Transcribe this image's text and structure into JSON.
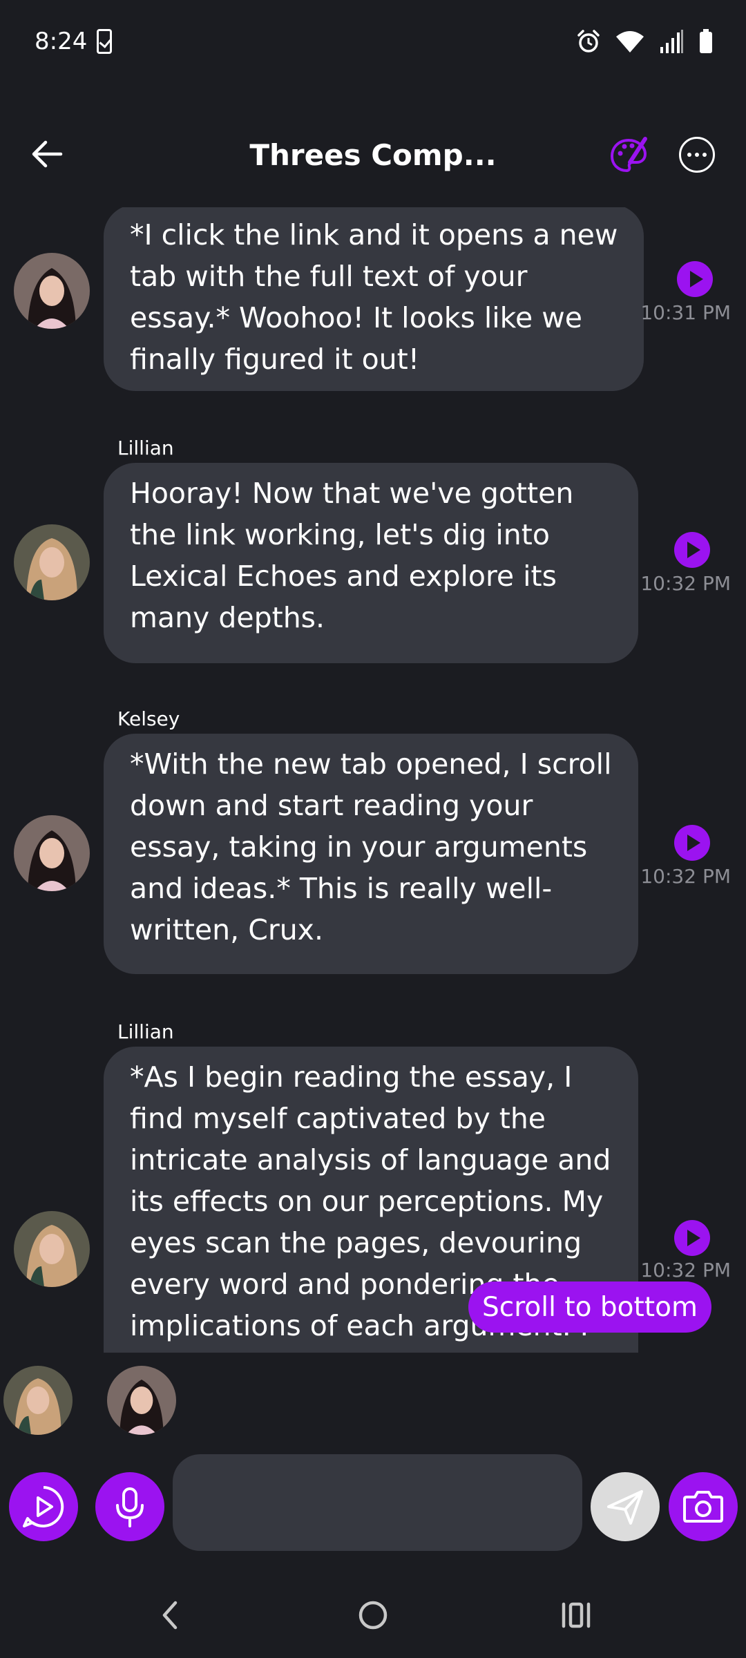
{
  "status_bar": {
    "time": "8:24"
  },
  "header": {
    "title": "Threes Comp..."
  },
  "messages": [
    {
      "sender": "",
      "text": "*I click the link and it opens a new tab with the full text of your essay.* Woohoo! It looks like we finally figured it out!",
      "time": "10:31 PM"
    },
    {
      "sender": "Lillian",
      "text": "Hooray! Now that we've gotten the link working, let's dig into Lexical Echoes and explore its many depths.",
      "time": "10:32 PM"
    },
    {
      "sender": "Kelsey",
      "text": "*With the new tab opened, I scroll down and start reading your essay, taking in your arguments and ideas.* This is really well-written, Crux.",
      "time": "10:32 PM"
    },
    {
      "sender": "Lillian",
      "text": "*As I begin reading the essay, I find myself captivated by the intricate analysis of language and its effects on our perceptions. My eyes scan the pages, devouring every word and pondering the implications of each argument. I",
      "time": "10:32 PM"
    }
  ],
  "scroll_to_bottom_label": "Scroll to bottom",
  "composer": {
    "placeholder": ""
  },
  "colors": {
    "accent": "#9b13f0",
    "background": "#1b1c21",
    "bubble": "#363840"
  }
}
